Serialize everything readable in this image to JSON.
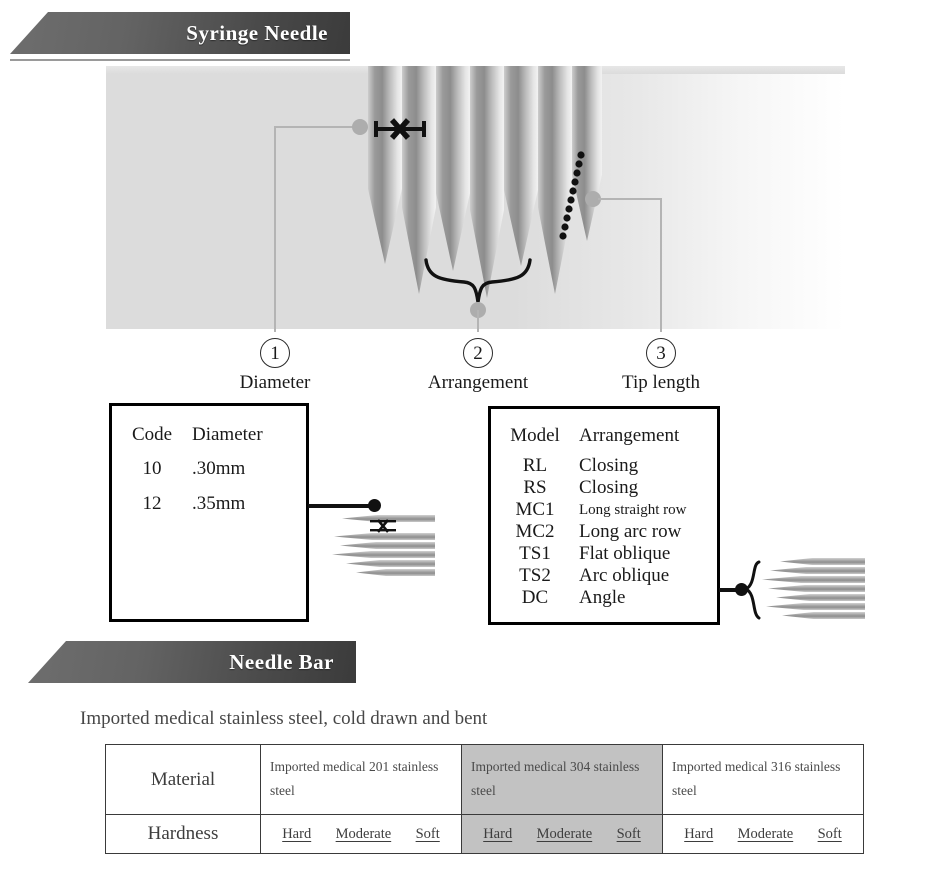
{
  "sections": [
    {
      "id": "syringe-needle",
      "title": "Syringe Needle"
    },
    {
      "id": "needle-bar",
      "title": "Needle Bar"
    }
  ],
  "callouts": [
    {
      "number": "1",
      "label": "Diameter"
    },
    {
      "number": "2",
      "label": "Arrangement"
    },
    {
      "number": "3",
      "label": "Tip length"
    }
  ],
  "diameter_table": {
    "headers": [
      "Code",
      "Diameter"
    ],
    "rows": [
      [
        "10",
        ".30mm"
      ],
      [
        "12",
        ".35mm"
      ]
    ]
  },
  "arrangement_table": {
    "headers": [
      "Model",
      "Arrangement"
    ],
    "rows": [
      [
        "RL",
        "Closing"
      ],
      [
        "RS",
        "Closing"
      ],
      [
        "MC1",
        "Long straight row"
      ],
      [
        "MC2",
        "Long arc row"
      ],
      [
        "TS1",
        "Flat oblique"
      ],
      [
        "TS2",
        "Arc oblique"
      ],
      [
        "DC",
        "Angle"
      ]
    ]
  },
  "needle_bar": {
    "caption": "Imported medical stainless steel, cold drawn and bent",
    "row_labels": [
      "Material",
      "Hardness"
    ],
    "columns": [
      {
        "material": "Imported medical 201 stainless steel",
        "hardness_options": [
          "Hard",
          "Moderate",
          "Soft"
        ],
        "highlighted": false
      },
      {
        "material": "Imported medical 304 stainless steel",
        "hardness_options": [
          "Hard",
          "Moderate",
          "Soft"
        ],
        "highlighted": true
      },
      {
        "material": "Imported medical 316 stainless steel",
        "hardness_options": [
          "Hard",
          "Moderate",
          "Soft"
        ],
        "highlighted": false
      }
    ]
  },
  "colors": {
    "banner_dark": "#3b3b3b",
    "banner_light": "#6e6e6e",
    "panel_bg": "#dcdcdc",
    "needle_gray": "#8f8f8f",
    "leader_gray": "#b4b4b4",
    "highlight_gray": "#c2c2c2",
    "ink": "#1a1a1a"
  }
}
